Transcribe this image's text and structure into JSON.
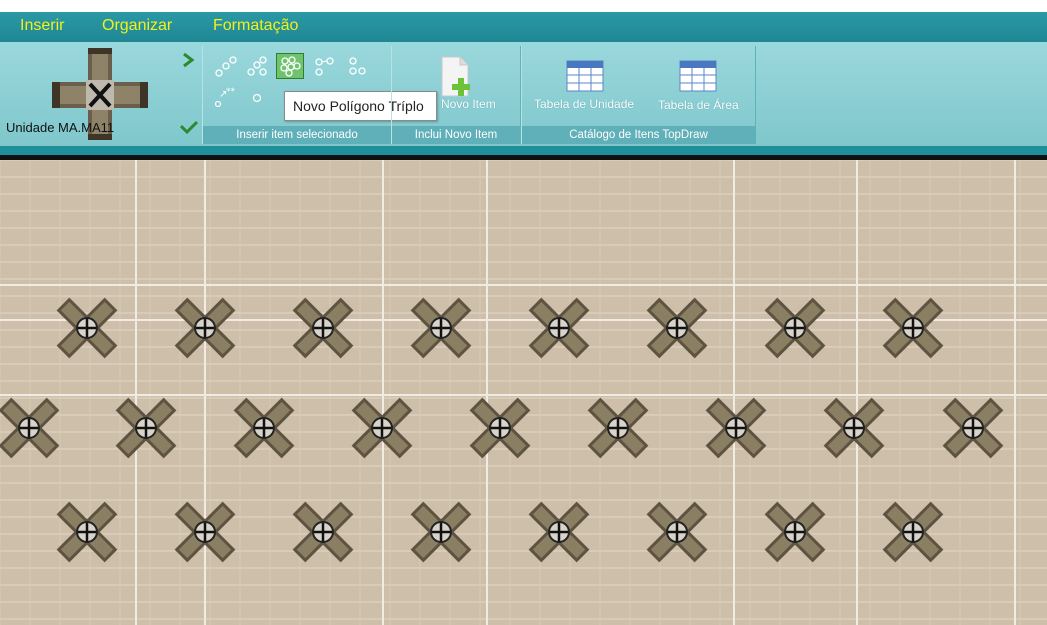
{
  "menu": {
    "items": [
      "Inserir",
      "Organizar",
      "Formatação"
    ]
  },
  "unit": {
    "name": "Unidade MA.MA11"
  },
  "tools": [
    {
      "icon": "polygon-single-icon"
    },
    {
      "icon": "polygon-double-icon"
    },
    {
      "icon": "polygon-triple-icon",
      "selected": true
    },
    {
      "icon": "polygon-chain-icon"
    },
    {
      "icon": "polygon-pair-icon"
    },
    {
      "icon": "scatter-icon"
    },
    {
      "icon": "circle-small-icon"
    }
  ],
  "tooltip": {
    "text": "Novo Polígono Tríplo"
  },
  "groups": {
    "insert_selected": "Inserir item selecionado",
    "new_item": "Inclui Novo Item",
    "catalog": "Catálogo de Itens TopDraw"
  },
  "buttons": {
    "new_item": "Novo Item",
    "unit_table": "Tabela de Unidade",
    "area_table": "Tabela de Área"
  },
  "colors": {
    "menu_text": "#f3f01c",
    "ribbon": "#8fd1d5",
    "accent": "#1f8f99",
    "floor": "#cdbfa9"
  }
}
